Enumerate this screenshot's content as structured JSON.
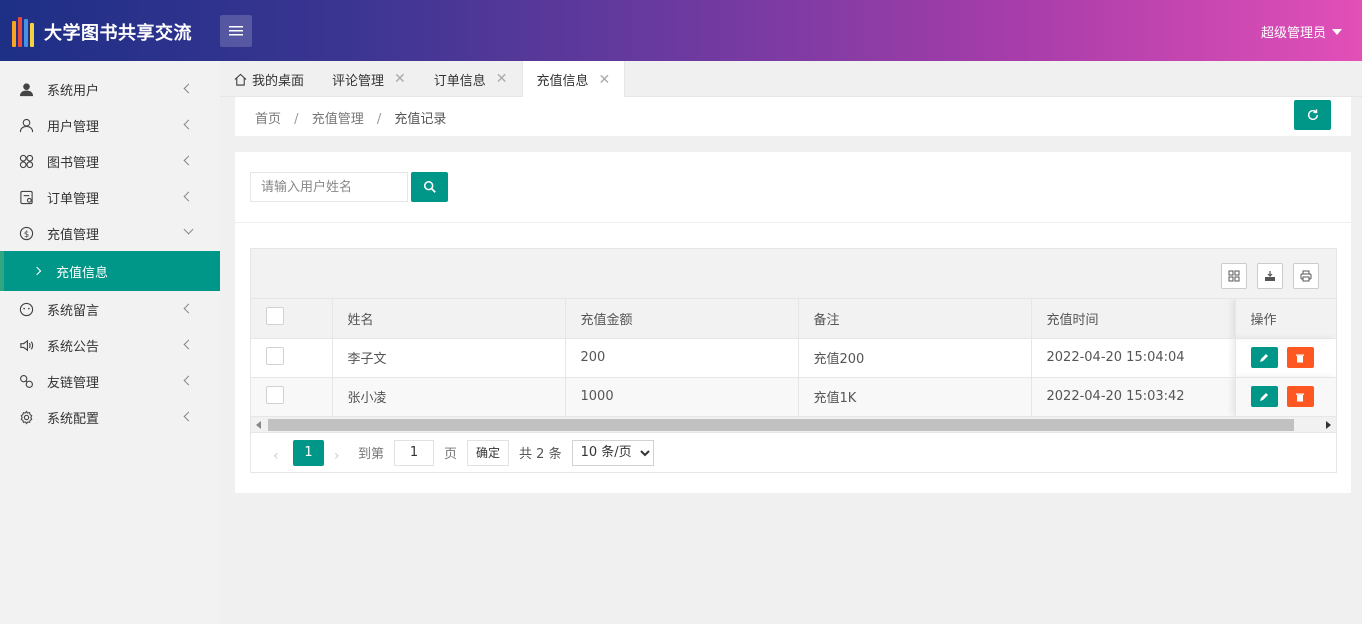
{
  "app": {
    "title": "大学图书共享交流",
    "user": "超级管理员"
  },
  "sidebar": {
    "items": [
      {
        "label": "系统用户",
        "icon": "person-filled-icon"
      },
      {
        "label": "用户管理",
        "icon": "person-outline-icon"
      },
      {
        "label": "图书管理",
        "icon": "grid-icon"
      },
      {
        "label": "订单管理",
        "icon": "order-icon"
      },
      {
        "label": "充值管理",
        "icon": "dollar-icon"
      },
      {
        "label": "系统留言",
        "icon": "face-icon"
      },
      {
        "label": "系统公告",
        "icon": "speaker-icon"
      },
      {
        "label": "友链管理",
        "icon": "link-icon"
      },
      {
        "label": "系统配置",
        "icon": "gear-icon"
      }
    ],
    "sub_active": "充值信息"
  },
  "tabs": [
    {
      "label": "我的桌面"
    },
    {
      "label": "评论管理"
    },
    {
      "label": "订单信息"
    },
    {
      "label": "充值信息"
    }
  ],
  "breadcrumb": {
    "home": "首页",
    "level1": "充值管理",
    "current": "充值记录",
    "sep": "/"
  },
  "search": {
    "placeholder": "请输入用户姓名"
  },
  "table": {
    "headers": {
      "name": "姓名",
      "amount": "充值金额",
      "note": "备注",
      "time": "充值时间",
      "ops": "操作"
    },
    "rows": [
      {
        "name": "李子文",
        "amount": "200",
        "note": "充值200",
        "time": "2022-04-20 15:04:04"
      },
      {
        "name": "张小凌",
        "amount": "1000",
        "note": "充值1K",
        "time": "2022-04-20 15:03:42"
      }
    ]
  },
  "pager": {
    "current": "1",
    "goto_label": "到第",
    "goto_value": "1",
    "page_label": "页",
    "confirm": "确定",
    "total": "共 2 条",
    "page_size": "10 条/页"
  },
  "colors": {
    "accent": "#009688",
    "danger": "#ff5722"
  }
}
